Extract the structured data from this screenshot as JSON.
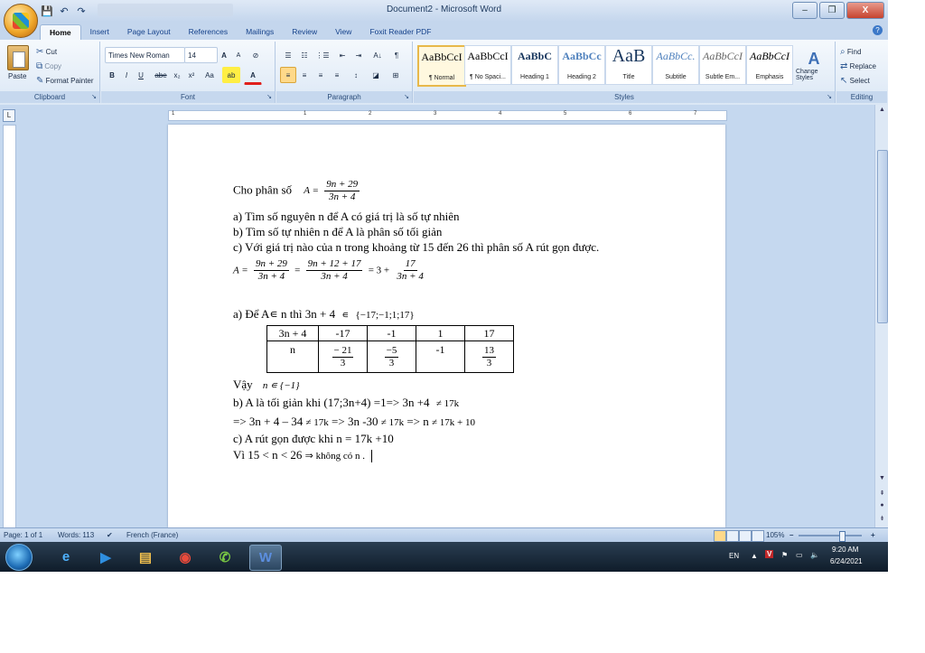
{
  "app": {
    "title": "Document2 - Microsoft Word"
  },
  "qat": {
    "save": "💾",
    "undo": "↶",
    "redo": "↷"
  },
  "window": {
    "minimize": "–",
    "maximize": "❐",
    "close": "X"
  },
  "tabs": [
    "Home",
    "Insert",
    "Page Layout",
    "References",
    "Mailings",
    "Review",
    "View",
    "Foxit Reader PDF"
  ],
  "ribbon": {
    "clipboard": {
      "label": "Clipboard",
      "paste": "Paste",
      "cut": "Cut",
      "copy": "Copy",
      "format_painter": "Format Painter"
    },
    "font": {
      "label": "Font",
      "family": "Times New Roman",
      "size": "14",
      "grow": "A",
      "shrink": "A",
      "clear": "⊘",
      "bold": "B",
      "italic": "I",
      "underline": "U",
      "strike": "abe",
      "subscript": "x₂",
      "superscript": "x²",
      "case": "Aa",
      "highlight": "ab",
      "color": "A"
    },
    "paragraph": {
      "label": "Paragraph",
      "bullets": "☰",
      "numbering": "☷",
      "multilevel": "⋮☰",
      "decrease_indent": "⇤",
      "increase_indent": "⇥",
      "sort": "A↓",
      "show_marks": "¶",
      "align_left": "≡",
      "center": "≡",
      "align_right": "≡",
      "justify": "≡",
      "line_spacing": "↕",
      "shading": "◪",
      "borders": "⊞"
    },
    "styles": {
      "label": "Styles",
      "items": [
        {
          "preview": "AaBbCcI",
          "name": "¶ Normal"
        },
        {
          "preview": "AaBbCcI",
          "name": "¶ No Spaci..."
        },
        {
          "preview": "AaBbC",
          "name": "Heading 1"
        },
        {
          "preview": "AaBbCc",
          "name": "Heading 2"
        },
        {
          "preview": "AaB",
          "name": "Title"
        },
        {
          "preview": "AaBbCc.",
          "name": "Subtitle"
        },
        {
          "preview": "AaBbCcI",
          "name": "Subtle Em..."
        },
        {
          "preview": "AaBbCcI",
          "name": "Emphasis"
        }
      ],
      "change_styles": "Change Styles"
    },
    "editing": {
      "label": "Editing",
      "find": "Find",
      "replace": "Replace",
      "select": "Select"
    }
  },
  "ruler": {
    "corner": "L",
    "marks": [
      "1",
      "1",
      "2",
      "3",
      "4",
      "5",
      "6",
      "7"
    ]
  },
  "document": {
    "l1_text": "Cho phân số",
    "l1_lhs": "A =",
    "l1_num": "9n + 29",
    "l1_den": "3n + 4",
    "l2": "a) Tìm số nguyên n để A có giá trị là số tự nhiên",
    "l3": "b) Tìm số tự nhiên n để A là phân số tối giản",
    "l4": "c) Với giá trị nào của n trong khoảng từ 15 đến 26 thì phân số A rút gọn được.",
    "eq_lhs": "A =",
    "eq_f1_num": "9n + 29",
    "eq_f1_den": "3n + 4",
    "eq_eq1": "=",
    "eq_f2_num": "9n + 12 + 17",
    "eq_f2_den": "3n + 4",
    "eq_eq2": "= 3 +",
    "eq_f3_num": "17",
    "eq_f3_den": "3n + 4",
    "la_text": "a) Để A∊ n thì  3n + 4",
    "la_in": "∊",
    "la_set": "{−17;−1;1;17}",
    "table": {
      "row1": [
        "3n + 4",
        "-17",
        "-1",
        "1",
        "17"
      ],
      "row2_label": "n",
      "row2_c1_num": "− 21",
      "row2_c1_den": "3",
      "row2_c2_num": "−5",
      "row2_c2_den": "3",
      "row2_c3": "-1",
      "row2_c4_num": "13",
      "row2_c4_den": "3"
    },
    "vay_text": "Vậy",
    "vay_math": "n ∊ {−1}",
    "lb1_text": "b)  A là tối giản khi (17;3n+4) =1=> 3n +4",
    "lb1_neq": "≠ 17k",
    "lb2_text": "=> 3n + 4 – 34",
    "lb2_neq1": "≠ 17k",
    "lb2_mid": " => 3n -30",
    "lb2_neq2": "≠ 17k",
    "lb2_mid2": " => n",
    "lb2_neq3": "≠ 17k + 10",
    "lc": "c)   A rút gọn được khi n = 17k +10",
    "lvi_text": "Vì 15 < n <  26",
    "lvi_math": "⇒ không có  n ."
  },
  "status": {
    "page": "Page: 1 of 1",
    "words": "Words: 113",
    "lang": "French (France)",
    "zoom": "105%",
    "zoom_out": "–",
    "zoom_in": "+"
  },
  "taskbar": {
    "items": [
      {
        "name": "ie",
        "glyph": "e",
        "color": "#4fb3ff"
      },
      {
        "name": "media",
        "glyph": "▶",
        "color": "#2f8fe0"
      },
      {
        "name": "explorer",
        "glyph": "▤",
        "color": "#f2c14e"
      },
      {
        "name": "chrome",
        "glyph": "◉",
        "color": "#e94b3c"
      },
      {
        "name": "viber",
        "glyph": "✆",
        "color": "#7ac943"
      },
      {
        "name": "word",
        "glyph": "W",
        "color": "#5c8fe0"
      }
    ],
    "lang": "EN",
    "time": "9:20 AM",
    "date": "6/24/2021"
  }
}
